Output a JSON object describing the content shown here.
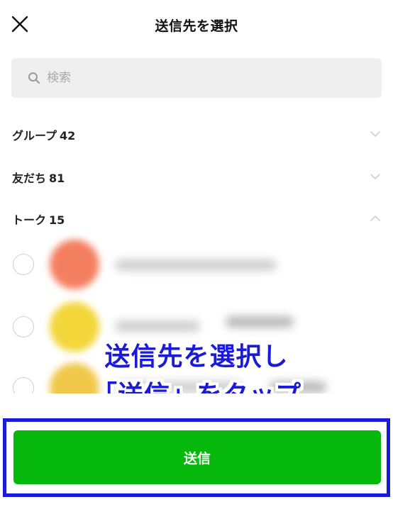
{
  "header": {
    "title": "送信先を選択",
    "close_icon": "close-icon"
  },
  "search": {
    "placeholder": "検索",
    "value": ""
  },
  "sections": [
    {
      "label": "グループ",
      "count": "42",
      "expanded": false
    },
    {
      "label": "友だち",
      "count": "81",
      "expanded": false
    },
    {
      "label": "トーク",
      "count": "15",
      "expanded": true
    }
  ],
  "annotation": {
    "line1": "送信先を選択し",
    "line2": "「送信」をタップ"
  },
  "send_button": {
    "label": "送信"
  },
  "colors": {
    "accent_green": "#06b70c",
    "annotation_blue": "#1a1ad9",
    "search_bg": "#efefef"
  }
}
